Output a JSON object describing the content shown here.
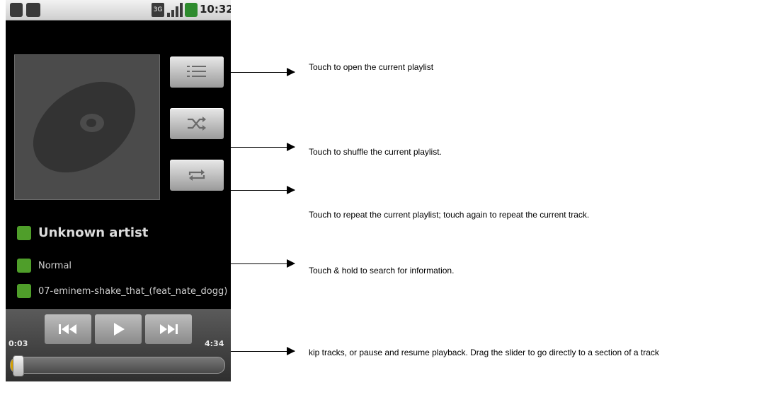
{
  "status_bar": {
    "time": "10:32",
    "network_label": "3G",
    "icons": [
      "usb-icon",
      "android-debug-icon",
      "network-3g-icon",
      "signal-icon",
      "battery-icon"
    ]
  },
  "now_playing": {
    "artist": "Unknown artist",
    "album": "Normal",
    "track": "07-eminem-shake_that_(feat_nate_dogg)"
  },
  "side_buttons": {
    "icons": [
      "playlist-icon",
      "shuffle-icon",
      "repeat-icon"
    ]
  },
  "playback": {
    "current_time": "0:03",
    "total_time": "4:34",
    "progress": 0.011
  },
  "annotations": [
    "Touch to open the current playlist",
    "Touch to shuffle the current playlist.",
    "Touch to repeat the current playlist; touch again to repeat the current track.",
    "Touch & hold to search for information.",
    "kip tracks, or pause and resume playback. Drag the slider to go directly to a section of a track"
  ],
  "colors": {
    "accent_green": "#4f9e2a",
    "progress_fill": "#d8a300",
    "background": "#000000"
  }
}
